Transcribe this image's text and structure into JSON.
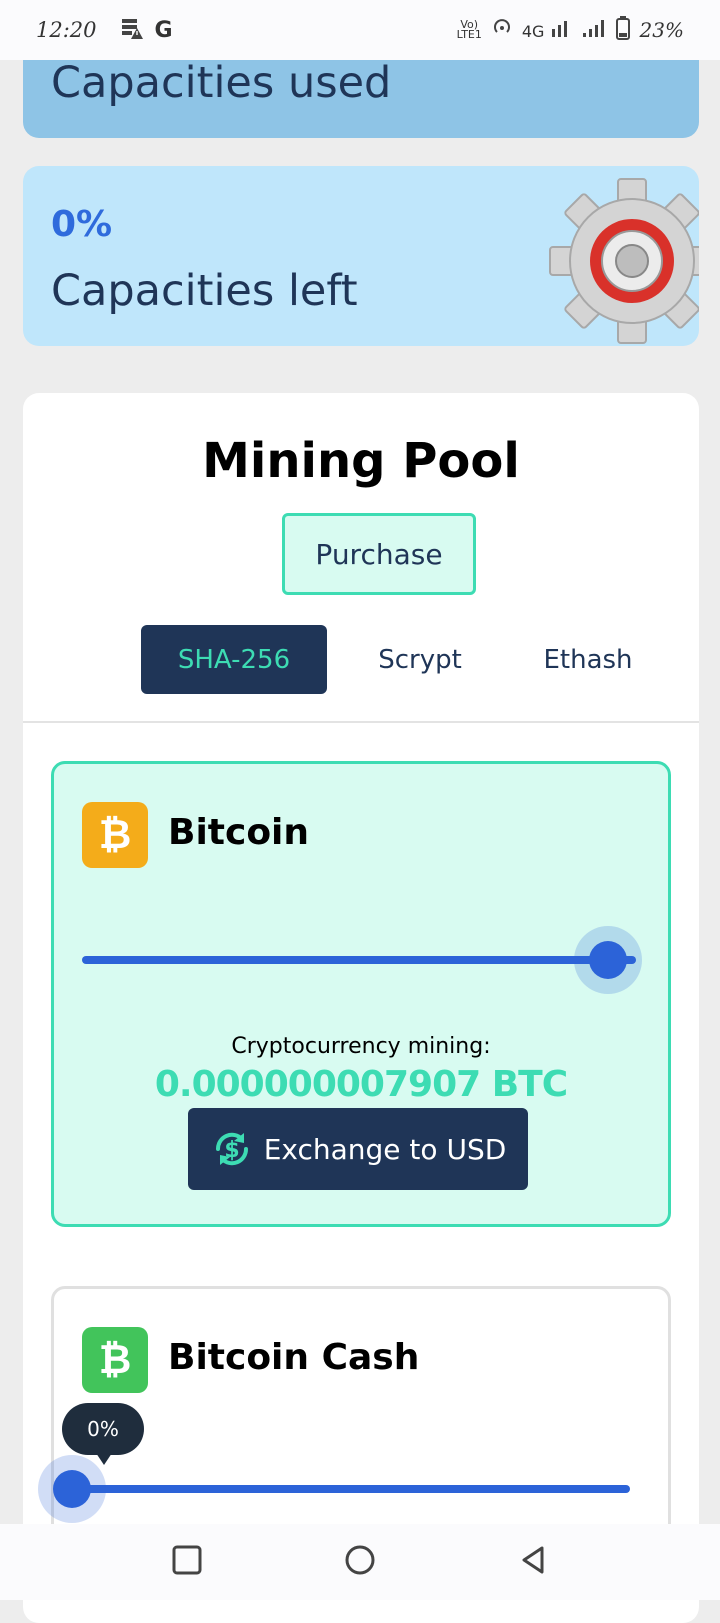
{
  "status_bar": {
    "time": "12:20",
    "left_icons": [
      "storage-warning-icon",
      "google-icon"
    ],
    "google_letter": "G",
    "right_icons": [
      "volte-icon",
      "hotspot-icon",
      "signal-4g-icon",
      "signal-icon",
      "battery-icon"
    ],
    "network": "4G",
    "battery": "23%"
  },
  "cards": {
    "used_label": "Capacities used",
    "left_percent": "0%",
    "left_label": "Capacities left"
  },
  "mining_pool": {
    "title": "Mining Pool",
    "purchase_label": "Purchase",
    "tabs": [
      "SHA-256",
      "Scrypt",
      "Ethash"
    ],
    "active_tab": "SHA-256"
  },
  "coins": [
    {
      "name": "Bitcoin",
      "symbol": "₿",
      "slider_fraction": 1.0,
      "mining_label": "Cryptocurrency mining:",
      "mining_value": "0.000000007907 BTC",
      "exchange_label": "Exchange to USD"
    },
    {
      "name": "Bitcoin Cash",
      "symbol": "₿",
      "slider_fraction": 0.0,
      "tooltip": "0%"
    }
  ],
  "colors": {
    "primary": "#1f3557",
    "accent": "#3ddcb3",
    "slider": "#2c63d8",
    "bitcoin": "#f4ac1a",
    "bitcoin_cash": "#42c45b"
  },
  "nav": [
    "recent-apps-icon",
    "home-icon",
    "back-icon"
  ]
}
